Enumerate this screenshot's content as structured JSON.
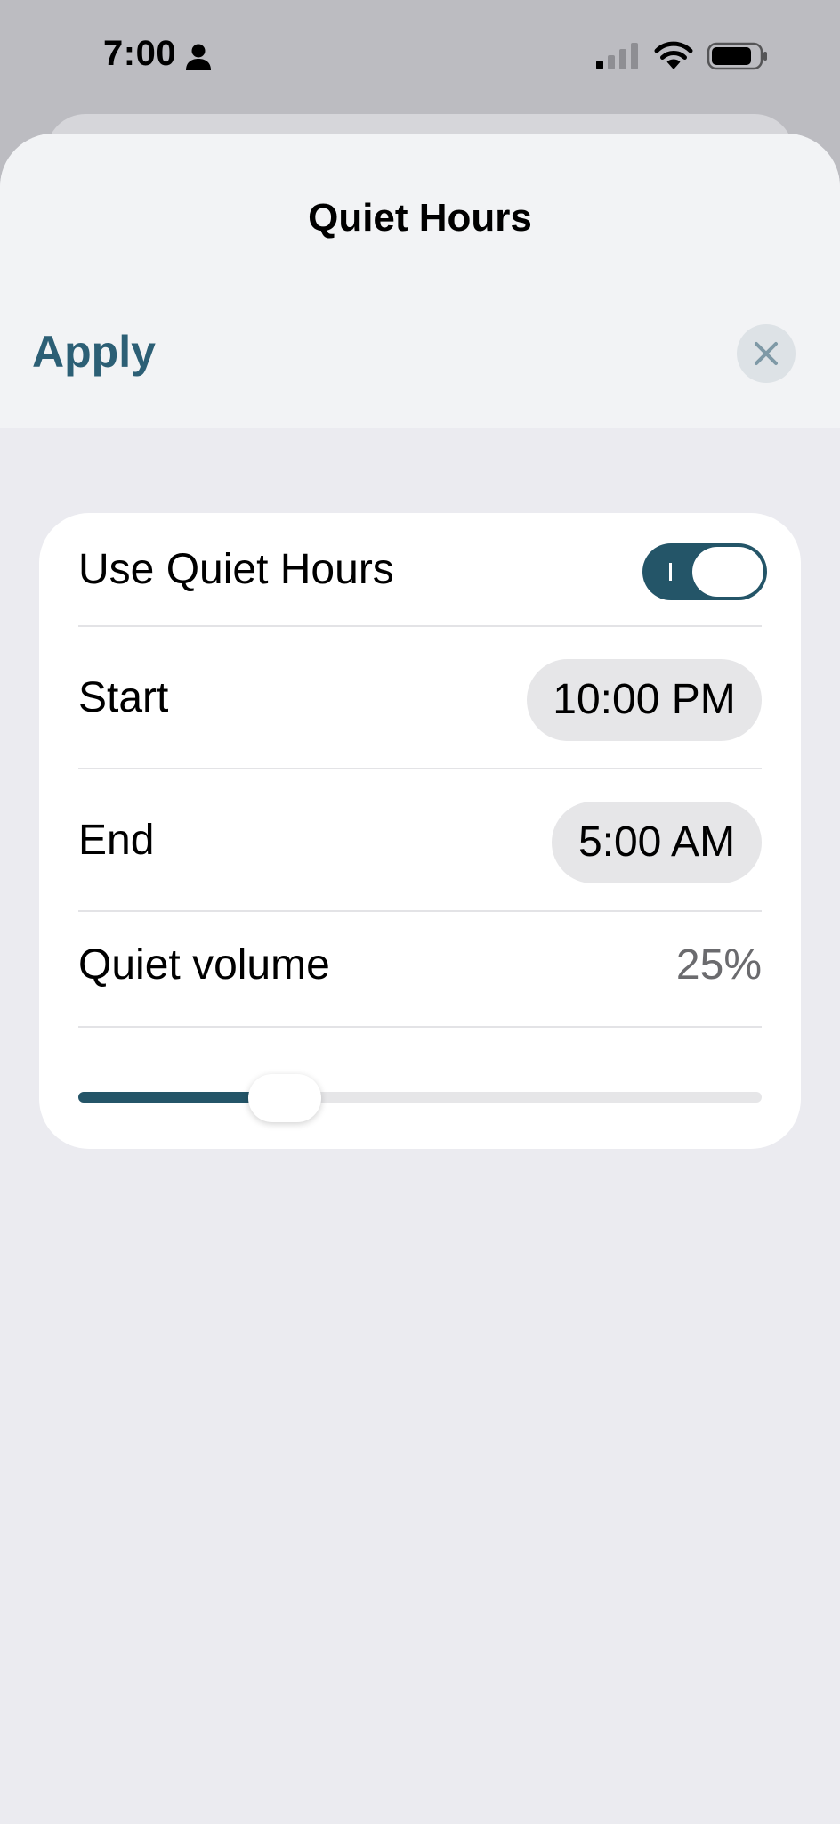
{
  "status_bar": {
    "time": "7:00"
  },
  "sheet": {
    "title": "Quiet Hours",
    "apply_label": "Apply"
  },
  "settings": {
    "use_quiet_hours_label": "Use Quiet Hours",
    "use_quiet_hours_enabled": true,
    "start_label": "Start",
    "start_value": "10:00 PM",
    "end_label": "End",
    "end_value": "5:00 AM",
    "volume_label": "Quiet volume",
    "volume_value": "25%",
    "volume_fraction": 0.25
  },
  "colors": {
    "accent": "#245568",
    "apply_text": "#2C5F75",
    "sheet_background": "#EBEBF0",
    "card_background": "#FFFFFF"
  },
  "icons": {
    "status_user": "person-icon",
    "cellular": "signal-icon",
    "wifi": "wifi-icon",
    "battery": "battery-icon",
    "close": "close-icon"
  }
}
